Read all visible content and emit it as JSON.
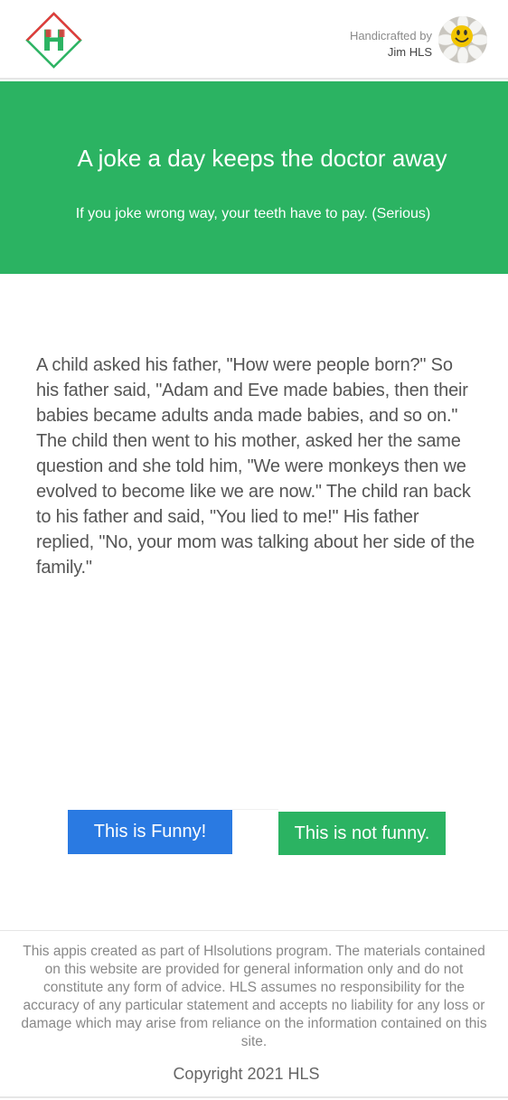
{
  "header": {
    "logo_icon": "hls-diamond-logo",
    "credit_prefix": "Handicrafted by",
    "credit_name": "Jim HLS",
    "avatar_icon": "smiley-flower-avatar"
  },
  "banner": {
    "title": "A joke a day keeps the doctor away",
    "subtitle": "If you joke wrong way, your teeth have to pay. (Serious)",
    "color": "#2bb362"
  },
  "joke": {
    "text": "A child asked his father, \"How were people born?\" So his father said, \"Adam and Eve made babies, then their babies became adults anda made babies, and so on.\" The child then went to his mother, asked her the same question and she told him, \"We were monkeys then we evolved to become like we are now.\" The child ran back to his father and said, \"You lied to me!\" His father replied, \"No, your mom was talking about her side of the family.\""
  },
  "actions": {
    "funny_label": "This is Funny!",
    "not_funny_label": "This is not funny.",
    "funny_color": "#2a7ae2",
    "not_funny_color": "#2bb362"
  },
  "footer": {
    "disclaimer": "This appis created as part of Hlsolutions program. The materials contained on this website are provided for general information only and do not constitute any form of advice. HLS assumes no responsibility for the accuracy of any particular statement and  accepts no liability for any loss or damage which may arise from reliance on the information contained on this site.",
    "copyright": "Copyright 2021 HLS"
  }
}
